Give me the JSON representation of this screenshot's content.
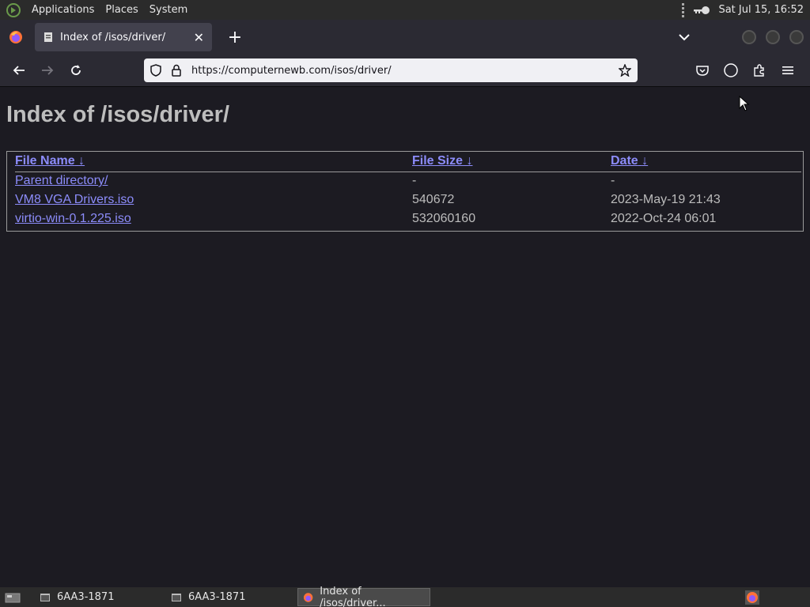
{
  "top_panel": {
    "menus": [
      "Applications",
      "Places",
      "System"
    ],
    "clock": "Sat Jul 15, 16:52"
  },
  "browser": {
    "tab": {
      "title": "Index of /isos/driver/"
    },
    "url": "https://computernewb.com/isos/driver/"
  },
  "page": {
    "heading": "Index of /isos/driver/",
    "columns": [
      {
        "label": "File Name",
        "sort": "↓"
      },
      {
        "label": "File Size",
        "sort": "↓"
      },
      {
        "label": "Date",
        "sort": "↓"
      }
    ],
    "rows": [
      {
        "name": "Parent directory/",
        "size": "-",
        "date": "-"
      },
      {
        "name": "VM8 VGA Drivers.iso",
        "size": "540672",
        "date": "2023-May-19 21:43"
      },
      {
        "name": "virtio-win-0.1.225.iso",
        "size": "532060160",
        "date": "2022-Oct-24 06:01"
      }
    ]
  },
  "taskbar": {
    "tasks": [
      {
        "label": "6AA3-1871"
      },
      {
        "label": "6AA3-1871"
      },
      {
        "label": "Index of /isos/driver..."
      }
    ]
  },
  "colors": {
    "link": "#8c8cfa",
    "background": "#1c1b22",
    "chrome": "#2b2a33"
  }
}
